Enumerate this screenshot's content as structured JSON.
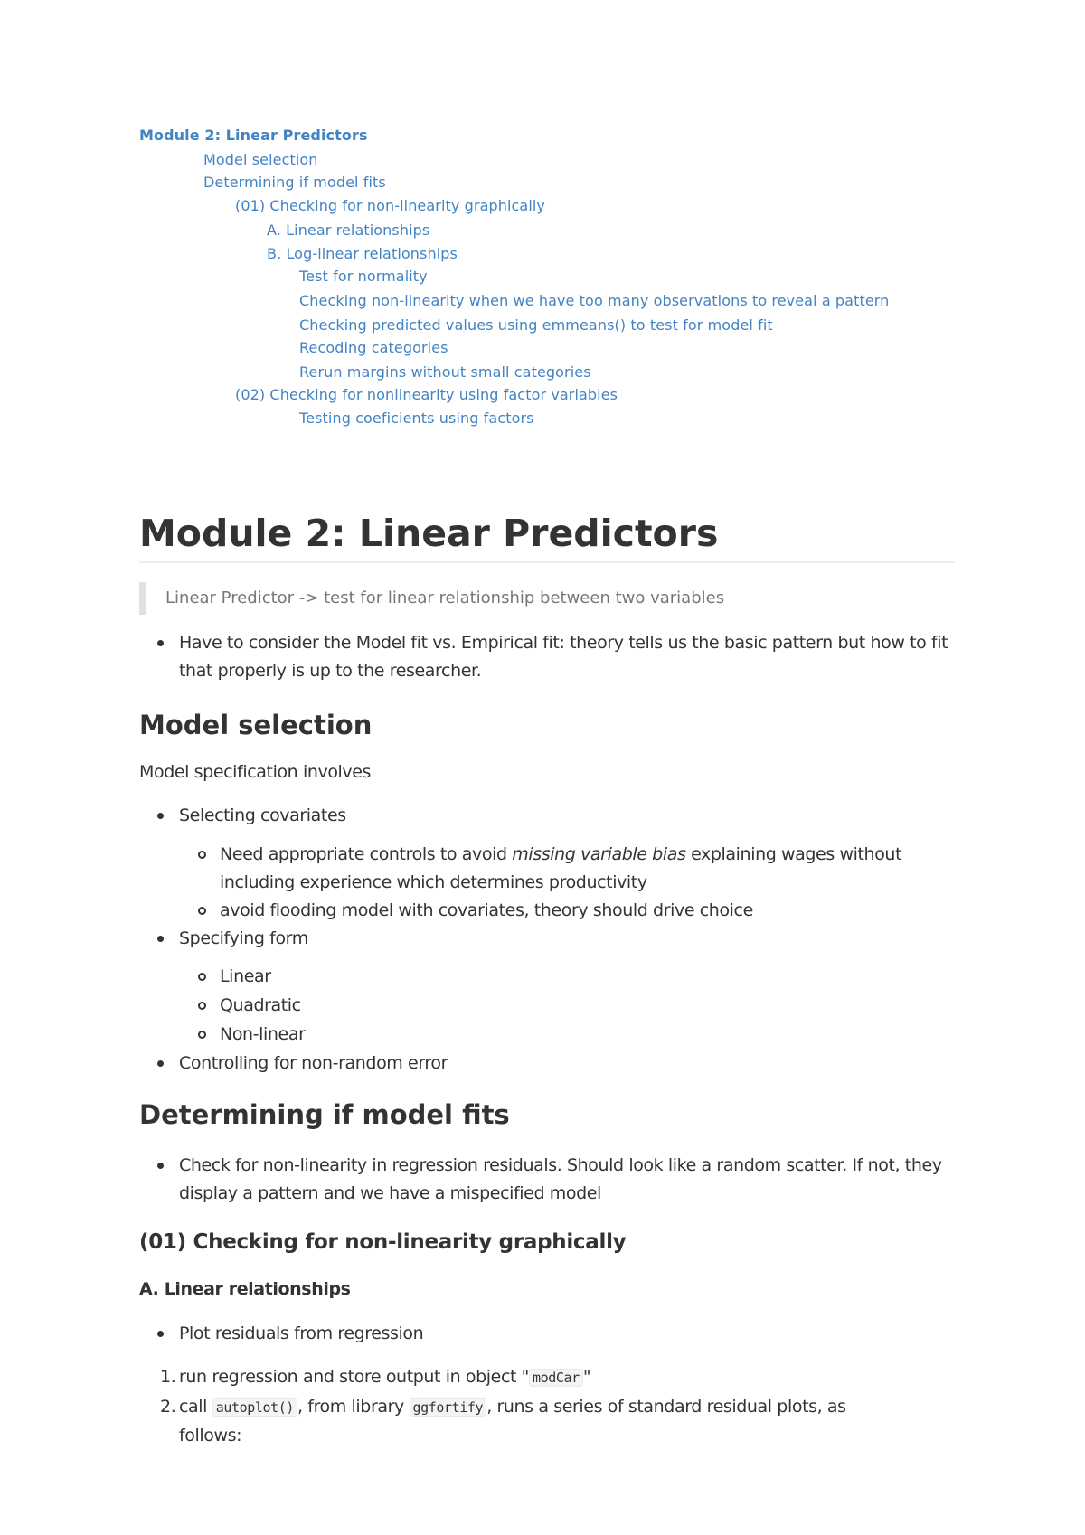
{
  "toc": {
    "items": [
      {
        "label": "Module 2: Linear Predictors",
        "level": 0
      },
      {
        "label": "Model selection",
        "level": 1
      },
      {
        "label": "Determining if model fits",
        "level": 1
      },
      {
        "label": "(01) Checking for non-linearity graphically",
        "level": 2
      },
      {
        "label": "A. Linear relationships",
        "level": 3
      },
      {
        "label": "B. Log-linear relationships",
        "level": 3
      },
      {
        "label": "Test for normality",
        "level": 4
      },
      {
        "label": "Checking non-linearity when we have too many observations to reveal a pattern",
        "level": 4
      },
      {
        "label": "Checking predicted values using emmeans() to test for model fit",
        "level": 4
      },
      {
        "label": "Recoding categories",
        "level": 4
      },
      {
        "label": "Rerun margins without small categories",
        "level": 4
      },
      {
        "label": "(02) Checking for nonlinearity using factor variables",
        "level": 2
      },
      {
        "label": "Testing coeficients using factors",
        "level": 4
      }
    ]
  },
  "doc": {
    "title": "Module 2: Linear Predictors",
    "blockquote": "Linear Predictor -> test for linear relationship between two variables",
    "intro_bullet_line1": "Have to consider the Model fit vs. Empirical fit: theory tells us the basic pattern but how to fit",
    "intro_bullet_line2": "that properly is up to the researcher.",
    "model_selection": {
      "heading": "Model selection",
      "paragraph": "Model specification involves",
      "bullet1": "Selecting covariates",
      "sub1_pre": "Need appropriate controls to avoid ",
      "sub1_em": "missing variable bias",
      "sub1_post": " explaining wages without",
      "sub1_line2": "including experience which determines productivity",
      "sub2": "avoid flooding model with covariates, theory should drive choice",
      "bullet2": "Specifying form",
      "forms": [
        "Linear",
        "Quadratic",
        "Non-linear"
      ],
      "bullet3": "Controlling for non-random error"
    },
    "model_fit": {
      "heading": "Determining if model fits",
      "bullet_line1": "Check for non-linearity in regression residuals. Should look like a random scatter. If not, they",
      "bullet_line2": "display a pattern and we have a mispecified model"
    },
    "graphical": {
      "heading": "(01) Checking for non-linearity graphically",
      "subheading": "A. Linear relationships",
      "bullet": "Plot residuals from regression",
      "step1_num": "1.",
      "step1_pre": "run regression and store output in object \"",
      "step1_code": "modCar",
      "step1_post": "\"",
      "step2_num": "2.",
      "step2_pre": "call ",
      "step2_code1": "autoplot()",
      "step2_mid": ", from library ",
      "step2_code2": "ggfortify",
      "step2_post": ", runs a series of standard residual plots, as",
      "step2_line2": "follows:"
    }
  }
}
